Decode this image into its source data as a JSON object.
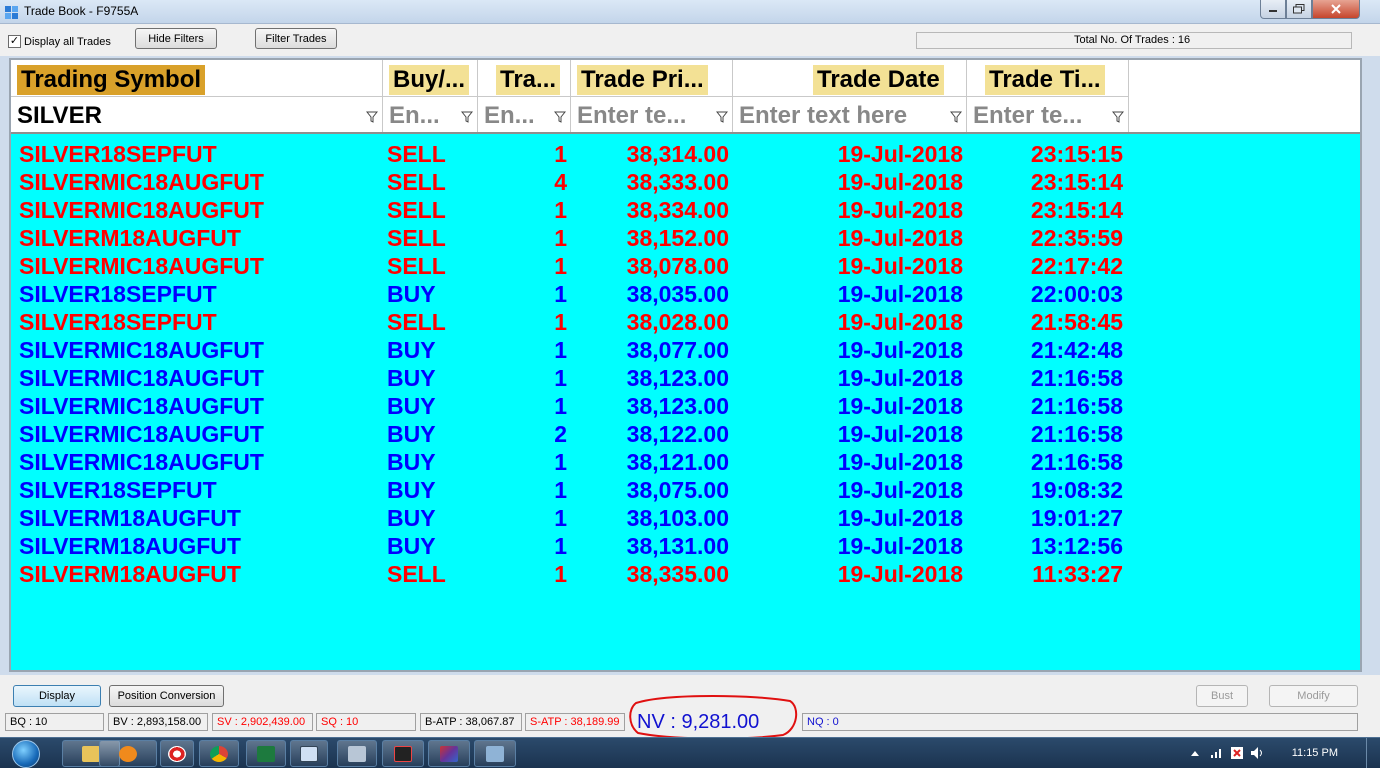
{
  "window": {
    "title": "Trade Book - F9755A"
  },
  "toolbar": {
    "display_all_label": "Display all Trades",
    "display_all_checked": true,
    "hide_filters_label": "Hide Filters",
    "filter_trades_label": "Filter Trades",
    "total_trades_text": "Total No. Of Trades : 16"
  },
  "columns": [
    {
      "label": "Trading Symbol",
      "filter": "SILVER",
      "filter_active": true
    },
    {
      "label": "Buy/...",
      "filter": "En...",
      "filter_active": false
    },
    {
      "label": "Tra...",
      "filter": "En...",
      "filter_active": false
    },
    {
      "label": "Trade Pri...",
      "filter": "Enter te...",
      "filter_active": false
    },
    {
      "label": "Trade Date",
      "filter": "Enter text here",
      "filter_active": false
    },
    {
      "label": "Trade Ti...",
      "filter": "Enter te...",
      "filter_active": false
    }
  ],
  "colors": {
    "grid_bg": "#00ffff",
    "header_label_active": "#d9a12a",
    "header_label": "#f3e195",
    "sell": "#ff0000",
    "buy": "#0000ff"
  },
  "trades": [
    {
      "symbol": "SILVER18SEPFUT",
      "side": "SELL",
      "qty": "1",
      "price": "38,314.00",
      "date": "19-Jul-2018",
      "time": "23:15:15"
    },
    {
      "symbol": "SILVERMIC18AUGFUT",
      "side": "SELL",
      "qty": "4",
      "price": "38,333.00",
      "date": "19-Jul-2018",
      "time": "23:15:14"
    },
    {
      "symbol": "SILVERMIC18AUGFUT",
      "side": "SELL",
      "qty": "1",
      "price": "38,334.00",
      "date": "19-Jul-2018",
      "time": "23:15:14"
    },
    {
      "symbol": "SILVERM18AUGFUT",
      "side": "SELL",
      "qty": "1",
      "price": "38,152.00",
      "date": "19-Jul-2018",
      "time": "22:35:59"
    },
    {
      "symbol": "SILVERMIC18AUGFUT",
      "side": "SELL",
      "qty": "1",
      "price": "38,078.00",
      "date": "19-Jul-2018",
      "time": "22:17:42"
    },
    {
      "symbol": "SILVER18SEPFUT",
      "side": "BUY",
      "qty": "1",
      "price": "38,035.00",
      "date": "19-Jul-2018",
      "time": "22:00:03"
    },
    {
      "symbol": "SILVER18SEPFUT",
      "side": "SELL",
      "qty": "1",
      "price": "38,028.00",
      "date": "19-Jul-2018",
      "time": "21:58:45"
    },
    {
      "symbol": "SILVERMIC18AUGFUT",
      "side": "BUY",
      "qty": "1",
      "price": "38,077.00",
      "date": "19-Jul-2018",
      "time": "21:42:48"
    },
    {
      "symbol": "SILVERMIC18AUGFUT",
      "side": "BUY",
      "qty": "1",
      "price": "38,123.00",
      "date": "19-Jul-2018",
      "time": "21:16:58"
    },
    {
      "symbol": "SILVERMIC18AUGFUT",
      "side": "BUY",
      "qty": "1",
      "price": "38,123.00",
      "date": "19-Jul-2018",
      "time": "21:16:58"
    },
    {
      "symbol": "SILVERMIC18AUGFUT",
      "side": "BUY",
      "qty": "2",
      "price": "38,122.00",
      "date": "19-Jul-2018",
      "time": "21:16:58"
    },
    {
      "symbol": "SILVERMIC18AUGFUT",
      "side": "BUY",
      "qty": "1",
      "price": "38,121.00",
      "date": "19-Jul-2018",
      "time": "21:16:58"
    },
    {
      "symbol": "SILVER18SEPFUT",
      "side": "BUY",
      "qty": "1",
      "price": "38,075.00",
      "date": "19-Jul-2018",
      "time": "19:08:32"
    },
    {
      "symbol": "SILVERM18AUGFUT",
      "side": "BUY",
      "qty": "1",
      "price": "38,103.00",
      "date": "19-Jul-2018",
      "time": "19:01:27"
    },
    {
      "symbol": "SILVERM18AUGFUT",
      "side": "BUY",
      "qty": "1",
      "price": "38,131.00",
      "date": "19-Jul-2018",
      "time": "13:12:56"
    },
    {
      "symbol": "SILVERM18AUGFUT",
      "side": "SELL",
      "qty": "1",
      "price": "38,335.00",
      "date": "19-Jul-2018",
      "time": "11:33:27"
    }
  ],
  "bottom": {
    "display_label": "Display",
    "position_conversion_label": "Position Conversion",
    "bust_label": "Bust",
    "modify_label": "Modify"
  },
  "status": {
    "bq": "BQ : 10",
    "bv": "BV : 2,893,158.00",
    "sv": "SV : 2,902,439.00",
    "sq": "SQ : 10",
    "batp": "B-ATP : 38,067.87",
    "satp": "S-ATP : 38,189.99",
    "nv": "NV : 9,281.00",
    "nq": "NQ : 0"
  },
  "taskbar": {
    "clock": "11:15 PM",
    "items": [
      "explorer-icon",
      "media-player-icon",
      "lifebuoy-icon",
      "chrome-icon",
      "excel-icon",
      "window-icon",
      "calculator-icon",
      "chart-app-icon",
      "prism-app-icon",
      "remote-icon"
    ]
  }
}
